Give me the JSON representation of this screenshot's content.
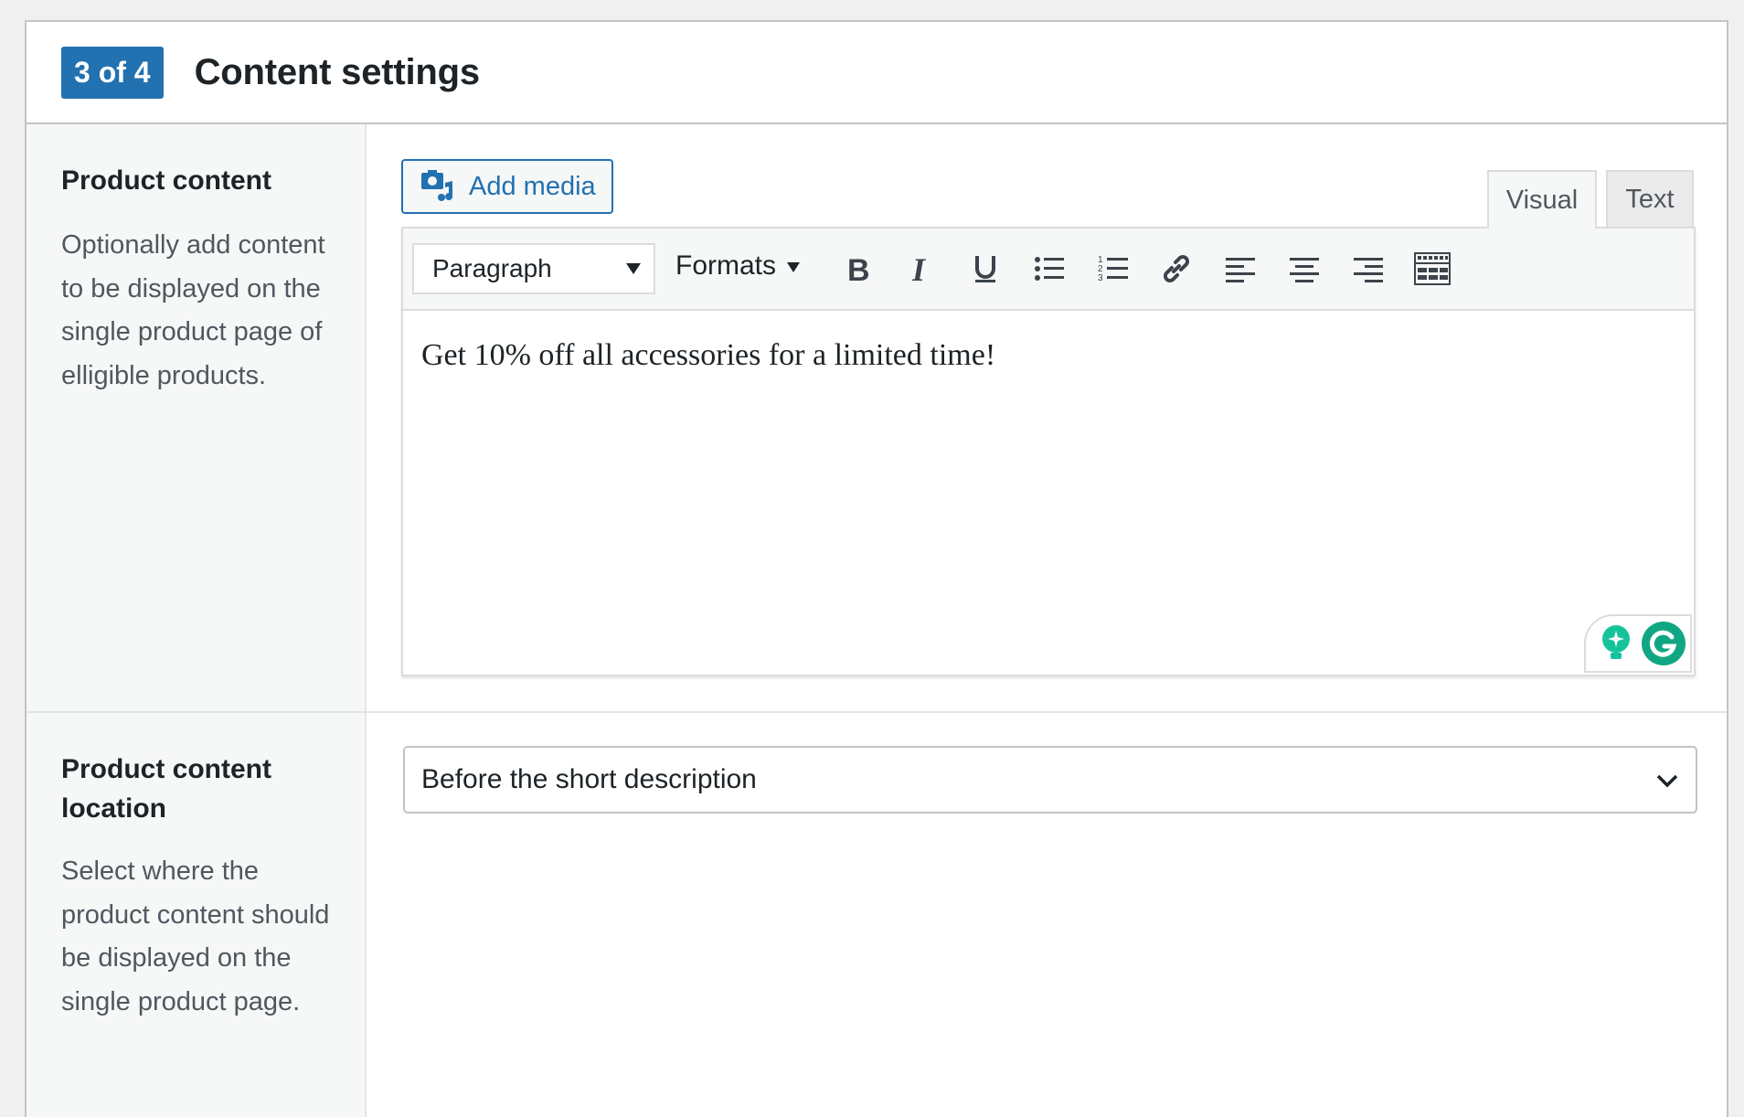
{
  "header": {
    "step_badge": "3 of 4",
    "title": "Content settings"
  },
  "product_content": {
    "label": "Product content",
    "description": "Optionally add content to be displayed on the single product page of elligible products.",
    "add_media_label": "Add media",
    "tabs": [
      {
        "label": "Visual",
        "active": true
      },
      {
        "label": "Text",
        "active": false
      }
    ],
    "toolbar": {
      "block_format": "Paragraph",
      "formats_label": "Formats",
      "buttons": [
        "bold-icon",
        "italic-icon",
        "underline-icon",
        "bullet-list-icon",
        "numbered-list-icon",
        "link-icon",
        "align-left-icon",
        "align-center-icon",
        "align-right-icon",
        "toolbar-toggle-icon"
      ]
    },
    "content": "Get 10% off all accessories for a limited time!"
  },
  "product_content_location": {
    "label": "Product content location",
    "description": "Select where the product content should be displayed on the single product page.",
    "selected": "Before the short description"
  },
  "colors": {
    "accent": "#2271b1",
    "grammarly": "#15c39a"
  }
}
